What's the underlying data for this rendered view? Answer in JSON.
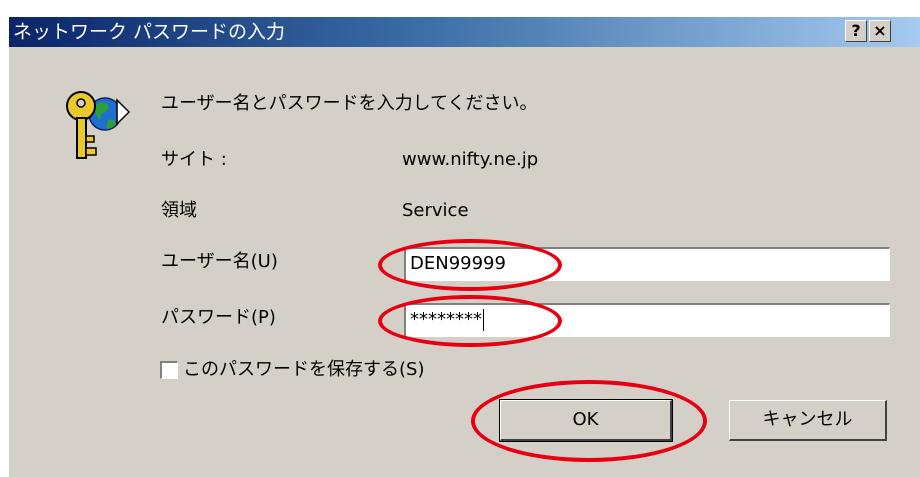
{
  "window": {
    "title": "ネットワーク パスワードの入力",
    "help_glyph": "?",
    "close_glyph": "×"
  },
  "icon": "keys-icon",
  "prompt": "ユーザー名とパスワードを入力してください。",
  "site": {
    "label": "サイト :",
    "value": "www.nifty.ne.jp"
  },
  "realm": {
    "label": "領域",
    "value": "Service"
  },
  "username": {
    "label": "ユーザー名(U)",
    "value": "DEN99999"
  },
  "password": {
    "label": "パスワード(P)",
    "value": "********"
  },
  "save_password": {
    "label": "このパスワードを保存する(S)",
    "checked": false
  },
  "buttons": {
    "ok": "OK",
    "cancel": "キャンセル"
  },
  "highlight_color": "#e60012"
}
